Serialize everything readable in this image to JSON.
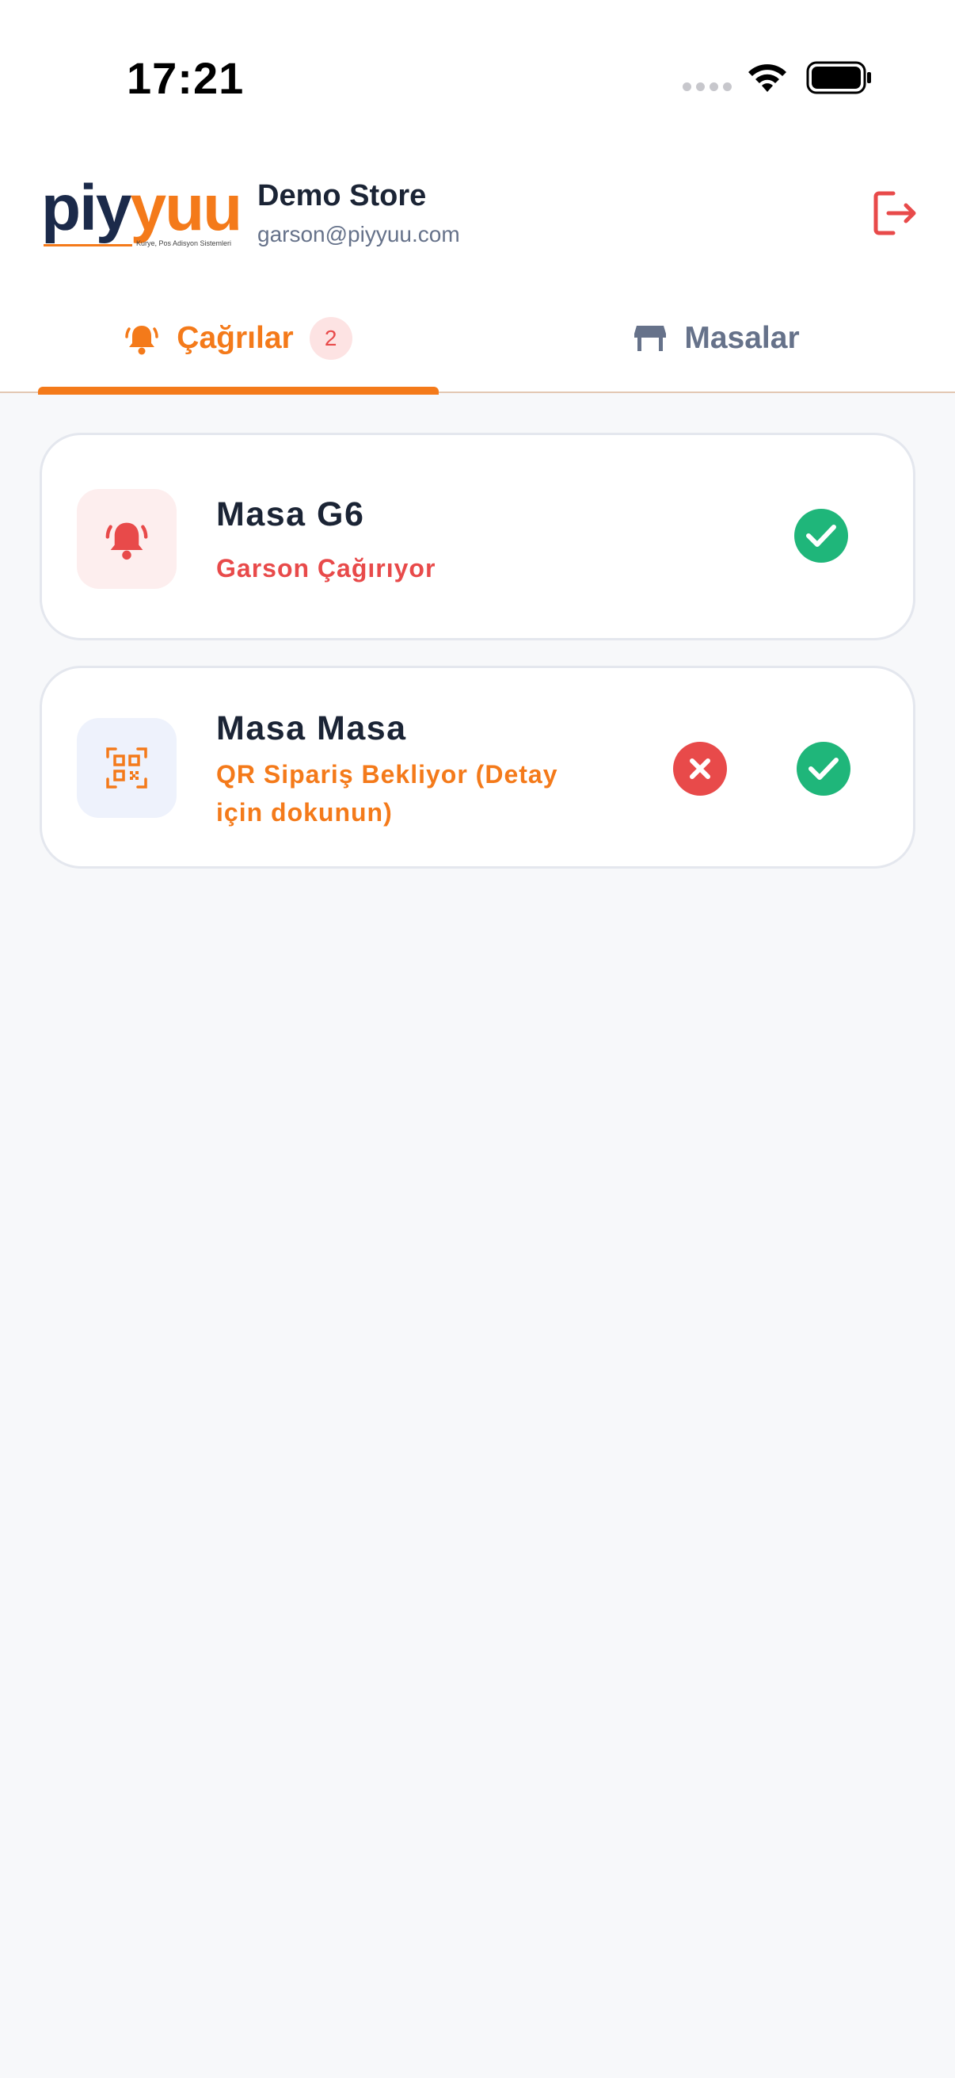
{
  "status_bar": {
    "time": "17:21"
  },
  "header": {
    "logo": {
      "brand_part1": "piy",
      "brand_part2": "yuu",
      "tagline": "Kurye, Pos Adisyon Sistemleri"
    },
    "store_name": "Demo Store",
    "email": "garson@piyyuu.com",
    "logout_icon": "logout-icon"
  },
  "tabs": [
    {
      "label": "Çağrılar",
      "icon": "bell-ring-icon",
      "badge": "2",
      "active": true
    },
    {
      "label": "Masalar",
      "icon": "table-icon",
      "active": false
    }
  ],
  "calls": [
    {
      "title": "Masa G6",
      "subtitle": "Garson Çağırıyor",
      "icon": "bell-ring-icon",
      "actions": [
        "approve"
      ]
    },
    {
      "title": "Masa Masa",
      "subtitle": "QR Sipariş Bekliyor (Detay için dokunun)",
      "icon": "qr-code-icon",
      "actions": [
        "reject",
        "approve"
      ]
    }
  ],
  "colors": {
    "accent": "#f47a1a",
    "danger": "#e84a4a",
    "success": "#1fb67a",
    "text_primary": "#1b2435",
    "text_secondary": "#66728a",
    "background": "#f7f8fa"
  }
}
